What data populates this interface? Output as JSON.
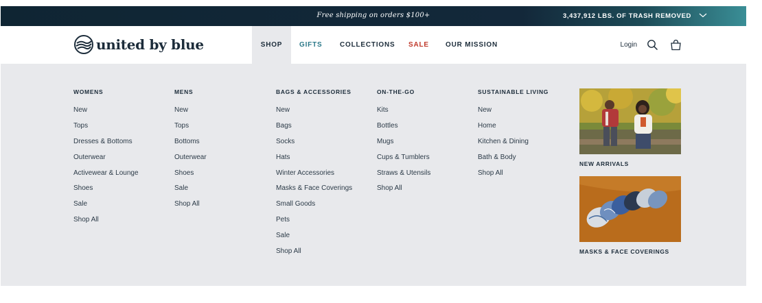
{
  "promo_bar": {
    "message": "Free shipping on orders $100+",
    "trash_counter": "3,437,912 LBS. OF TRASH REMOVED",
    "toggle_icon": "chevron-down-icon"
  },
  "header": {
    "brand": "united by blue",
    "nav": [
      {
        "label": "SHOP",
        "active": true
      },
      {
        "label": "GIFTS"
      },
      {
        "label": "COLLECTIONS"
      },
      {
        "label": "SALE",
        "color": "#c0392b"
      },
      {
        "label": "OUR MISSION"
      }
    ],
    "login_label": "Login",
    "search_icon": "search-icon",
    "cart_icon": "shopping-bag-icon"
  },
  "mega_menu": {
    "columns": [
      {
        "heading": "WOMENS",
        "links": [
          "New",
          "Tops",
          "Dresses & Bottoms",
          "Outerwear",
          "Activewear & Lounge",
          "Shoes",
          "Sale",
          "Shop All"
        ]
      },
      {
        "heading": "MENS",
        "links": [
          "New",
          "Tops",
          "Bottoms",
          "Outerwear",
          "Shoes",
          "Sale",
          "Shop All"
        ]
      },
      {
        "heading": "BAGS & ACCESSORIES",
        "links": [
          "New",
          "Bags",
          "Socks",
          "Hats",
          "Winter Accessories",
          "Masks & Face Coverings",
          "Small Goods",
          "Pets",
          "Sale",
          "Shop All"
        ]
      },
      {
        "heading": "ON-THE-GO",
        "links": [
          "Kits",
          "Bottles",
          "Mugs",
          "Cups & Tumblers",
          "Straws & Utensils",
          "Shop All"
        ]
      },
      {
        "heading": "SUSTAINABLE LIVING",
        "links": [
          "New",
          "Home",
          "Kitchen & Dining",
          "Bath & Body",
          "Shop All"
        ]
      }
    ],
    "promos": [
      {
        "label": "NEW ARRIVALS"
      },
      {
        "label": "MASKS & FACE COVERINGS"
      }
    ]
  },
  "colors": {
    "navy": "#13283a",
    "teal": "#2d7a8a",
    "sale_red": "#c0392b",
    "menu_bg": "#e8e9ec"
  }
}
